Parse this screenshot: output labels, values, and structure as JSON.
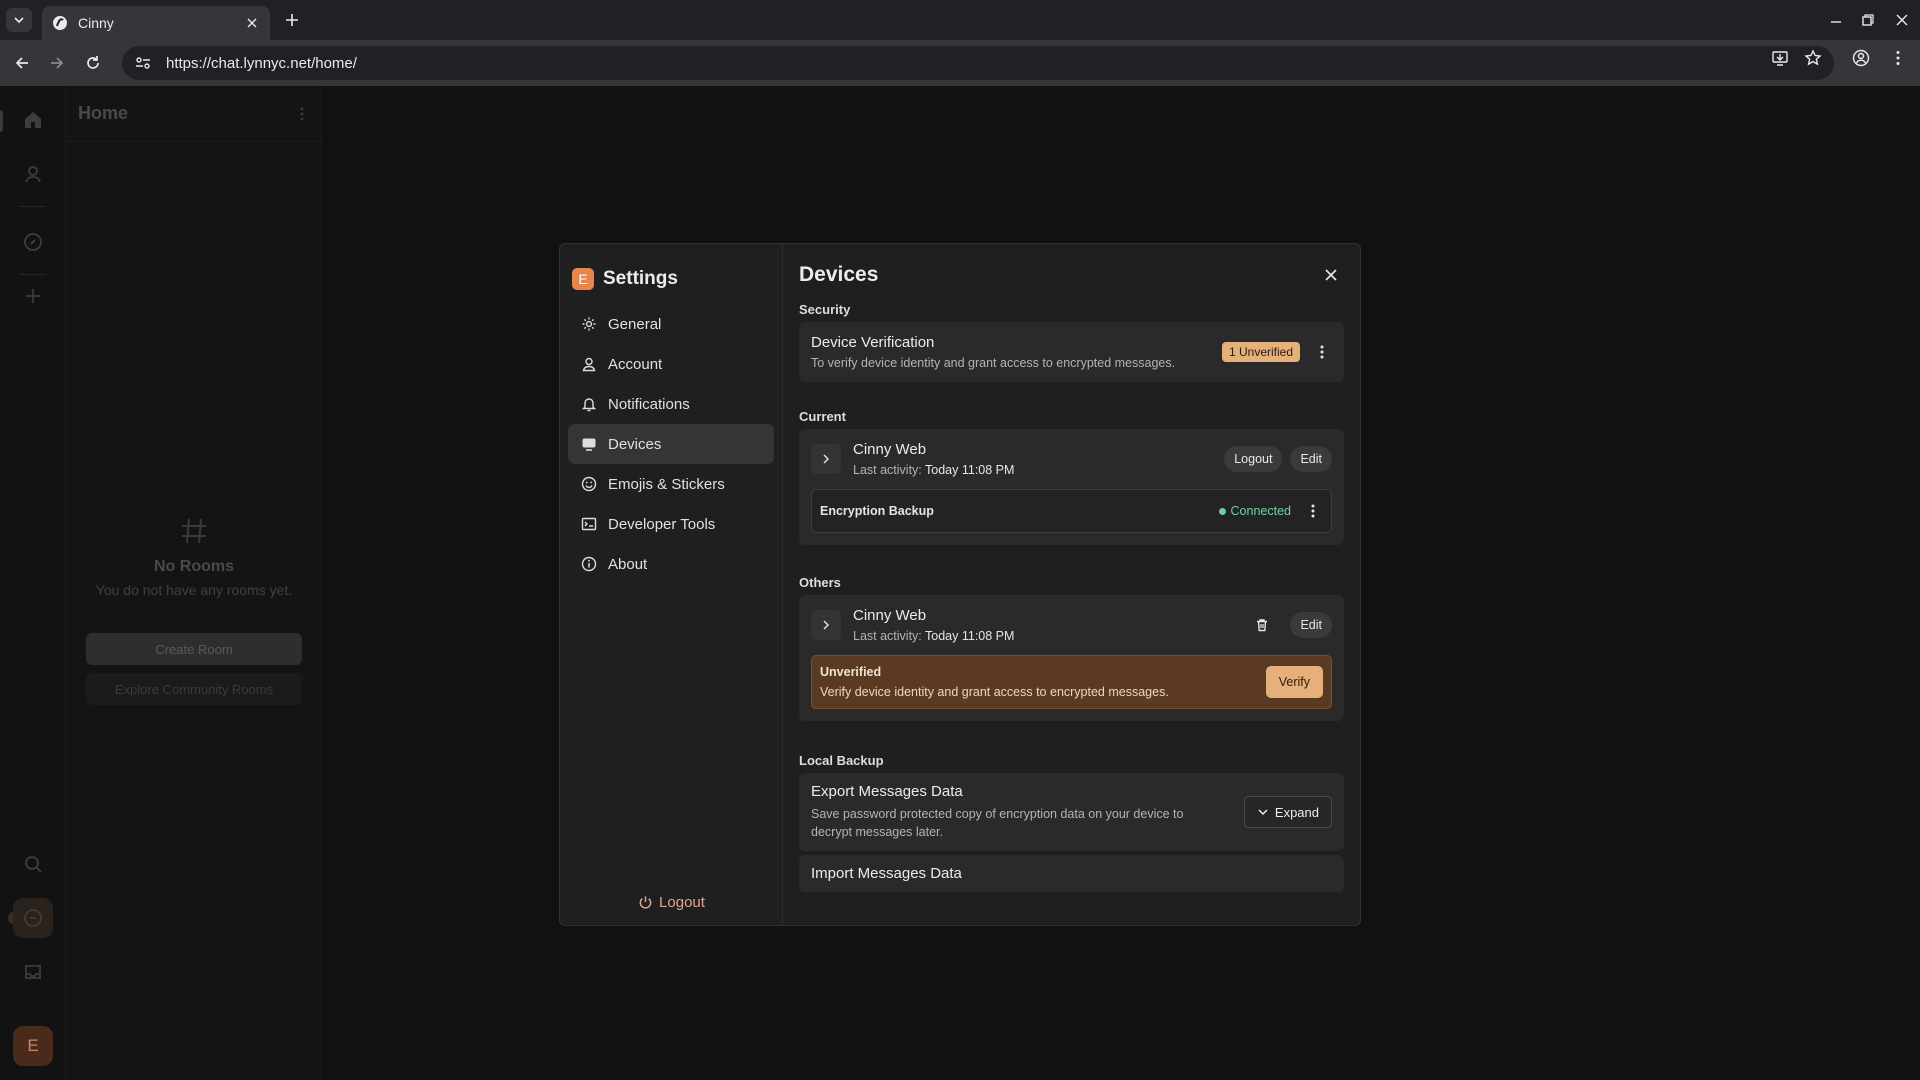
{
  "browser": {
    "tab_title": "Cinny",
    "url": "https://chat.lynnyc.net/home/"
  },
  "sidebar": {
    "title": "Home",
    "empty_title": "No Rooms",
    "empty_subtitle": "You do not have any rooms yet.",
    "create_room": "Create Room",
    "explore": "Explore Community Rooms",
    "user_initial": "E"
  },
  "settings": {
    "logo_letter": "E",
    "title": "Settings",
    "nav": [
      {
        "label": "General",
        "icon": "gear-icon"
      },
      {
        "label": "Account",
        "icon": "user-icon"
      },
      {
        "label": "Notifications",
        "icon": "bell-icon"
      },
      {
        "label": "Devices",
        "icon": "devices-icon"
      },
      {
        "label": "Emojis & Stickers",
        "icon": "smiley-icon"
      },
      {
        "label": "Developer Tools",
        "icon": "terminal-icon"
      },
      {
        "label": "About",
        "icon": "info-icon"
      }
    ],
    "logout": "Logout"
  },
  "devices": {
    "title": "Devices",
    "security": {
      "label": "Security",
      "title": "Device Verification",
      "subtitle": "To verify device identity and grant access to encrypted messages.",
      "badge": "1 Unverified"
    },
    "current": {
      "label": "Current",
      "device_name": "Cinny Web",
      "activity_prefix": "Last activity:",
      "activity_value": "Today 11:08 PM",
      "logout": "Logout",
      "edit": "Edit",
      "backup_title": "Encryption Backup",
      "backup_status": "Connected"
    },
    "others": {
      "label": "Others",
      "device_name": "Cinny Web",
      "activity_prefix": "Last activity:",
      "activity_value": "Today 11:08 PM",
      "edit": "Edit",
      "warn_title": "Unverified",
      "warn_subtitle": "Verify device identity and grant access to encrypted messages.",
      "verify": "Verify"
    },
    "local_backup": {
      "label": "Local Backup",
      "export_title": "Export Messages Data",
      "export_subtitle": "Save password protected copy of encryption data on your device to decrypt messages later.",
      "expand": "Expand",
      "import_title": "Import Messages Data"
    }
  },
  "colors": {
    "accent": "#e6864a",
    "warning": "#e6b07a",
    "connected": "#67d19b"
  }
}
